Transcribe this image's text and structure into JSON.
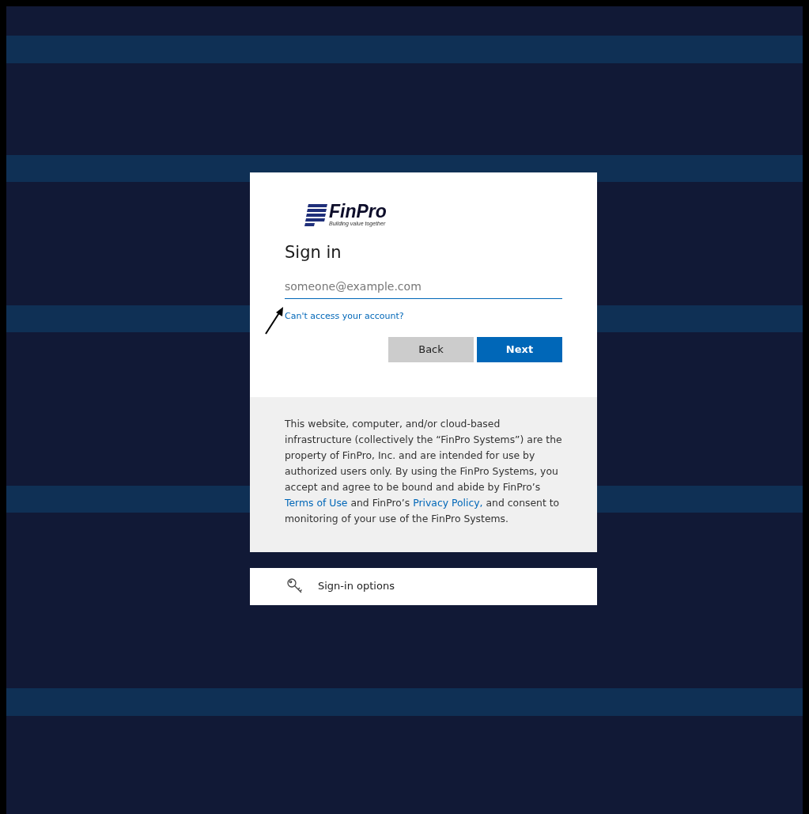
{
  "logo": {
    "name": "FinPro",
    "tagline": "Building value together"
  },
  "title": "Sign in",
  "email_field": {
    "placeholder": "someone@example.com"
  },
  "help_link": "Can't access your account?",
  "buttons": [
    {
      "label": "Back",
      "kind": "secondary"
    },
    {
      "label": "Next",
      "kind": "primary"
    }
  ],
  "disclaimer": [
    {
      "kind": "text",
      "text": "This website, computer, and/or cloud-based infrastructure (collectively the “FinPro Systems”) are the property of FinPro, Inc. and are intended for use by authorized users only. By using the FinPro Systems, you accept and agree to be bound and abide by FinPro’s "
    },
    {
      "kind": "link",
      "text": "Terms of Use"
    },
    {
      "kind": "text",
      "text": " and FinPro’s "
    },
    {
      "kind": "link",
      "text": "Privacy Policy,"
    },
    {
      "kind": "text",
      "text": " and consent to monitoring of your use of the FinPro Systems."
    }
  ],
  "sign_in_options": "Sign-in options"
}
